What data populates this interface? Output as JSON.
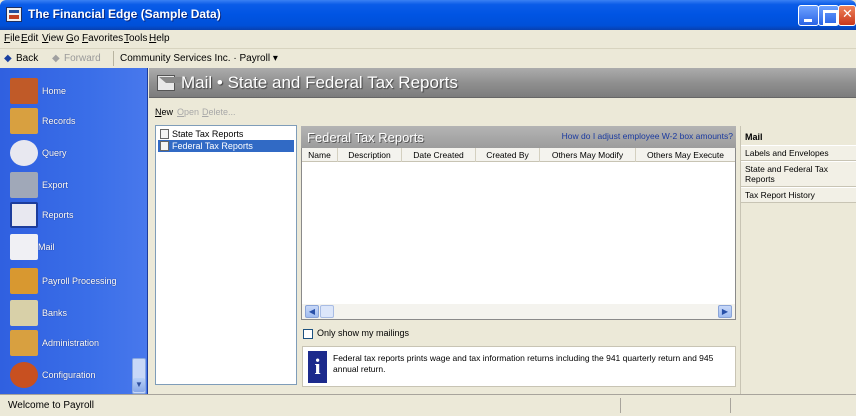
{
  "window": {
    "title": "The Financial Edge (Sample Data)"
  },
  "menu": {
    "items": [
      "File",
      "Edit",
      "View",
      "Go",
      "Favorites",
      "Tools",
      "Help"
    ]
  },
  "nav": {
    "back": "Back",
    "forward": "Forward",
    "breadcrumb": "Community Services Inc. · Payroll ▾"
  },
  "sidebar": {
    "items": [
      {
        "label": "Home",
        "icon": "home-icon",
        "color": "#c05a28"
      },
      {
        "label": "Records",
        "icon": "records-icon",
        "color": "#d8a040"
      },
      {
        "label": "Query",
        "icon": "query-icon",
        "color": "#e8e8f0"
      },
      {
        "label": "Export",
        "icon": "export-icon",
        "color": "#a0a8b8"
      },
      {
        "label": "Reports",
        "icon": "reports-icon",
        "color": "#e8e8f0"
      },
      {
        "label": "Mail",
        "icon": "mail-icon",
        "color": "#f0f0f4"
      },
      {
        "label": "Payroll Processing",
        "icon": "payroll-icon",
        "color": "#d89830"
      },
      {
        "label": "Banks",
        "icon": "banks-icon",
        "color": "#d8d0a8"
      },
      {
        "label": "Administration",
        "icon": "administration-icon",
        "color": "#d8a040"
      },
      {
        "label": "Configuration",
        "icon": "configuration-icon",
        "color": "#c85020"
      }
    ]
  },
  "header": {
    "title": "Mail • State and Federal Tax Reports"
  },
  "toolbar": {
    "new": "New",
    "open": "Open",
    "delete": "Delete..."
  },
  "tree": {
    "items": [
      {
        "label": "State Tax Reports",
        "selected": false
      },
      {
        "label": "Federal Tax Reports",
        "selected": true
      }
    ]
  },
  "main": {
    "title": "Federal Tax Reports",
    "help_link": "How do I adjust employee W-2 box amounts?",
    "columns": [
      "Name",
      "Description",
      "Date Created",
      "Created By",
      "Others May Modify",
      "Others May Execute"
    ],
    "checkbox_label": "Only show my mailings",
    "info_text": "Federal tax reports prints wage and tax information returns including the 941 quarterly return and 945 annual return."
  },
  "task_pane": {
    "heading": "Mail",
    "items": [
      "Labels and Envelopes",
      "State and Federal Tax Reports",
      "Tax Report History"
    ]
  },
  "status": {
    "text": "Welcome to Payroll"
  }
}
